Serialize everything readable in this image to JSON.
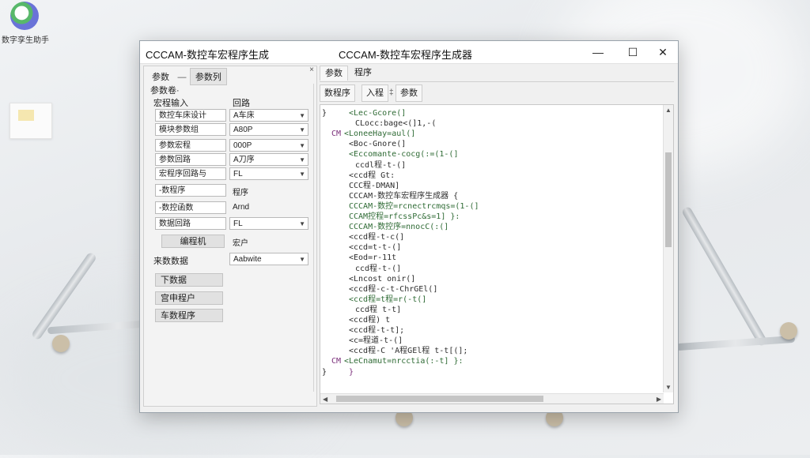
{
  "desktop": {
    "icon_label": "数字孪生助手"
  },
  "window": {
    "title_left": "CCCAM-数控车宏程序生成",
    "title_center": "CCCAM-数控车宏程序生成器",
    "min_glyph": "—",
    "max_glyph": "☐",
    "close_glyph": "✕"
  },
  "left": {
    "close_glyph": "×",
    "tabs": [
      {
        "label": "参数"
      },
      {
        "label": "参数列"
      }
    ],
    "tab_sep": "—",
    "group_label": "参数卷·",
    "header_left": "宏程输入",
    "header_right": "回路",
    "rows": [
      {
        "label": "数控车床设计",
        "value": "A车床"
      },
      {
        "label": "模块参数组",
        "value": "A80P"
      },
      {
        "label": "参数宏程",
        "value": "000P"
      },
      {
        "label": "参数回路",
        "value": "A刀序"
      },
      {
        "label": "宏程序回路与",
        "value": "FL"
      }
    ],
    "rows2": [
      {
        "label": "-数程序",
        "value": "程序"
      },
      {
        "label": "-数控函数",
        "value": "Arnd"
      },
      {
        "label": "数据回路",
        "value": "FL"
      }
    ],
    "generate_button": "编程机",
    "generate_value": "宏户",
    "footer_label": "来数数据",
    "footer_value": "Aabwite",
    "buttons": [
      {
        "label": "下数据"
      },
      {
        "label": "宫申程户"
      },
      {
        "label": "车数程序"
      }
    ]
  },
  "right": {
    "tabs": [
      {
        "label": "参数"
      },
      {
        "label": "程序"
      }
    ],
    "toolbar": [
      {
        "label": "数程序"
      },
      {
        "label": "入程"
      },
      {
        "label": "参数"
      }
    ],
    "toolbar_sep": "‡",
    "code_lines": [
      {
        "gutter": "}",
        "text": "<Lec-Gcore(]",
        "cls": "g"
      },
      {
        "gutter": "",
        "text": "CLocc:bage<(]1,-(",
        "cls": ""
      },
      {
        "gutter": "CM",
        "text": "<LoneeHay=aul(]",
        "cls": "g"
      },
      {
        "gutter": "",
        "text": "<Boc-Gnore(]",
        "cls": ""
      },
      {
        "gutter": "",
        "text": "<Eccomante-cocg(:=(1-(]",
        "cls": "g"
      },
      {
        "gutter": "",
        "text": "ccdl程-t-(]",
        "cls": ""
      },
      {
        "gutter": "",
        "text": "<ccd程 Gt:",
        "cls": ""
      },
      {
        "gutter": "",
        "text": "CCC程-DMAN]",
        "cls": ""
      },
      {
        "gutter": "",
        "text": "CCCAM-数控车宏程序生成器 {",
        "cls": ""
      },
      {
        "gutter": "",
        "text": "CCCAM-数控=rcnectrcmqs=(1-(]",
        "cls": "g"
      },
      {
        "gutter": "",
        "text": "CCAM控程=rfcssPc&s=1] }:",
        "cls": "g"
      },
      {
        "gutter": "",
        "text": "CCCAM-数控序=nnocC(:(]",
        "cls": "g"
      },
      {
        "gutter": "",
        "text": "<ccd程-t-c(]",
        "cls": ""
      },
      {
        "gutter": "",
        "text": "<ccd=t-t-(]",
        "cls": ""
      },
      {
        "gutter": "",
        "text": "<Eod=r-11t",
        "cls": ""
      },
      {
        "gutter": "",
        "text": "ccd程-t-(]",
        "cls": ""
      },
      {
        "gutter": "",
        "text": "<Lncost onir(]",
        "cls": ""
      },
      {
        "gutter": "",
        "text": "<ccd程-c-t-ChrGEl(]",
        "cls": ""
      },
      {
        "gutter": "",
        "text": "<ccd程=t程=r(-t(]",
        "cls": "g"
      },
      {
        "gutter": "",
        "text": "ccd程 t-t]",
        "cls": ""
      },
      {
        "gutter": "",
        "text": "<ccd程) t",
        "cls": ""
      },
      {
        "gutter": "",
        "text": "<ccd程-t-t];",
        "cls": ""
      },
      {
        "gutter": "",
        "text": "<c=程道-t-(]",
        "cls": ""
      },
      {
        "gutter": "",
        "text": "<ccd程-C 'A程GEl程 t-t[(];",
        "cls": ""
      },
      {
        "gutter": "CM",
        "text": "<LeCnamut=nrcctia(:-t] }:",
        "cls": "g"
      },
      {
        "gutter": "}",
        "text": "}",
        "cls": "p"
      }
    ]
  }
}
